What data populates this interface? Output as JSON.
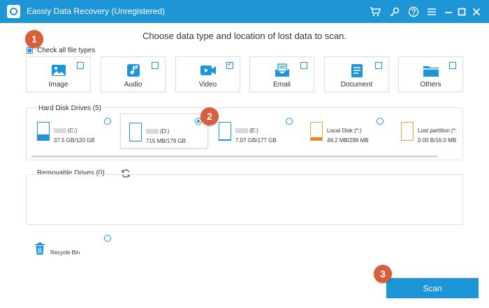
{
  "window": {
    "title": "Eassiy Data Recovery (Unregistered)",
    "accent": "#1e95d6",
    "icons": [
      "cart-icon",
      "key-icon",
      "help-icon",
      "menu-icon",
      "minimize-icon",
      "maximize-icon",
      "close-icon"
    ]
  },
  "header": {
    "title": "Choose data type and location of lost data to scan."
  },
  "steps": [
    "1",
    "2",
    "3"
  ],
  "check_all": {
    "label": "Check all file types",
    "checked": true
  },
  "file_types": [
    {
      "label": "Image",
      "icon": "image-icon",
      "checked": false
    },
    {
      "label": "Audio",
      "icon": "audio-icon",
      "checked": false
    },
    {
      "label": "Video",
      "icon": "video-icon",
      "checked": true
    },
    {
      "label": "Email",
      "icon": "email-icon",
      "checked": false
    },
    {
      "label": "Document",
      "icon": "document-icon",
      "checked": false
    },
    {
      "label": "Others",
      "icon": "folder-icon",
      "checked": false
    }
  ],
  "hard_disk": {
    "label": "Hard Disk Drives (5)",
    "drives": [
      {
        "name": "(C:)",
        "size": "37.5 GB/120 GB",
        "selected": false,
        "usage": 0.31,
        "color": "#1e95d6"
      },
      {
        "name": "(D:)",
        "size": "715 MB/179 GB",
        "selected": true,
        "usage": 0.0,
        "color": "#1e95d6"
      },
      {
        "name": "(E:)",
        "size": "7.07 GB/177 GB",
        "selected": false,
        "usage": 0.04,
        "color": "#1e95d6"
      },
      {
        "name": "Local Disk (*:)",
        "size": "49.2 MB/299 MB",
        "selected": false,
        "usage": 0.16,
        "color": "#f07f1a"
      },
      {
        "name": "Lost partition (*:",
        "size": "0.00  B/16.0 MB",
        "selected": false,
        "usage": 0.0,
        "color": "#f07f1a"
      }
    ]
  },
  "removable": {
    "label": "Removable Drives (0)"
  },
  "recycle_bin": {
    "label": "Recycle Bin"
  },
  "scan": {
    "label": "Scan"
  },
  "step_color": "#d95f3b"
}
